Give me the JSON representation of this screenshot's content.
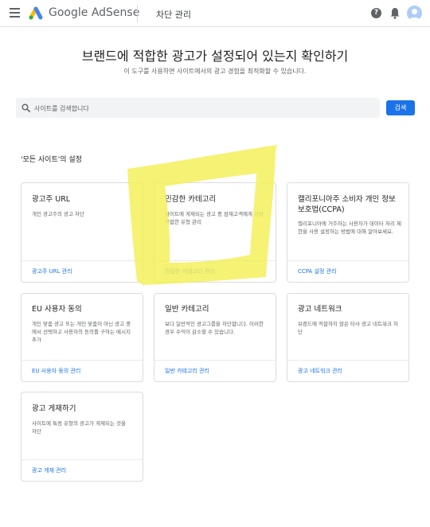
{
  "header": {
    "brand": "Google AdSense",
    "page_name": "차단 관리",
    "help_icon": "help-icon",
    "bell_icon": "notifications-icon"
  },
  "main": {
    "title": "브랜드에 적합한 광고가 설정되어 있는지 확인하기",
    "subtitle": "이 도구를 사용하면 사이트에서의 광고 경험을 최적화할 수 있습니다.",
    "search": {
      "placeholder": "사이트를 검색합니다",
      "button_label": "검색"
    },
    "section_title": "'모든 사이트'의 설정"
  },
  "cards": [
    {
      "title": "광고주 URL",
      "desc": "개인 광고주의 광고 차단",
      "link": "광고주 URL 관리"
    },
    {
      "title": "민감한 카테고리",
      "desc": "사이트에 게재되는 광고 중 잠재고객에게 가장 적합한 유형 관리",
      "link": "민감한 카테고리 관리"
    },
    {
      "title": "캘리포니아주 소비자 개인 정보 보호법(CCPA)",
      "desc": "캘리포니아에 거주하는 사용자가 데이터 처리 제한을 사용 설정하는 방법에 대해 알아보세요.",
      "link": "CCPA 설정 관리"
    },
    {
      "title": "EU 사용자 동의",
      "desc": "개인 맞춤 광고 또는 개인 맞춤이 아닌 광고 중에서 선택하고 사용자의 동의를 구하는 메시지 추가",
      "link": "EU 사용자 동의 관리"
    },
    {
      "title": "일반 카테고리",
      "desc": "보다 일반적인 광고그룹을 차단합니다. 이러한 경우 수익이 감소할 수 있습니다.",
      "link": "일반 카테고리 관리"
    },
    {
      "title": "광고 네트워크",
      "desc": "브랜드에 적합하지 않은 타사 광고 네트워크 차단",
      "link": "광고 네트워크 관리"
    },
    {
      "title": "광고 게재하기",
      "desc": "사이트에 특정 유형의 광고가 게재되는 것을 차단",
      "link": "광고 게재 관리"
    }
  ],
  "colors": {
    "accent": "#1a73e8",
    "highlight_scribble": "#f3ef55"
  }
}
